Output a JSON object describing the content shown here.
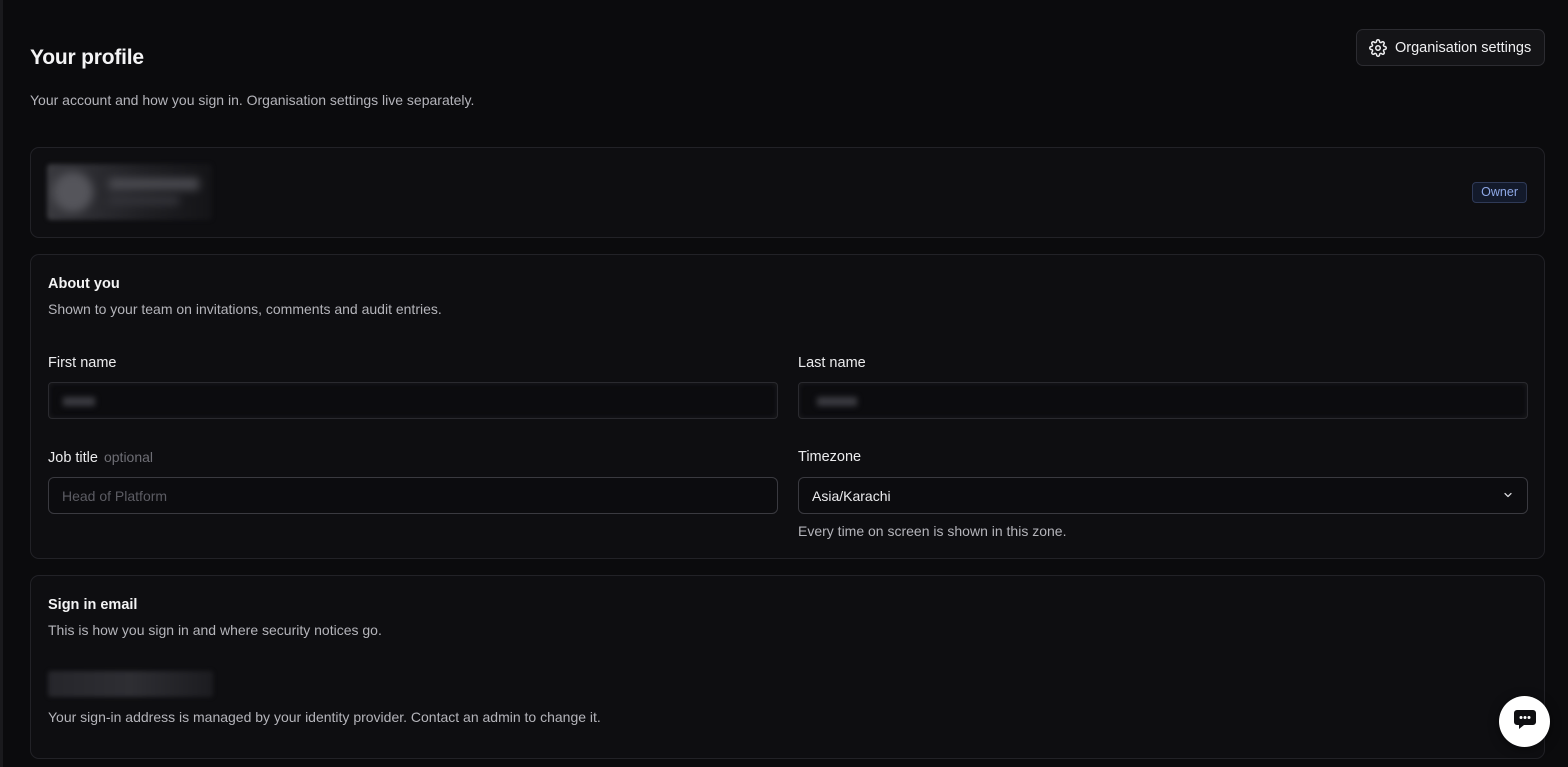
{
  "header": {
    "title": "Your profile",
    "subtitle": "Your account and how you sign in. Organisation settings live separately.",
    "org_settings_label": "Organisation settings"
  },
  "profile": {
    "role_badge": "Owner"
  },
  "about": {
    "title": "About you",
    "description": "Shown to your team on invitations, comments and audit entries.",
    "first_name_label": "First name",
    "last_name_label": "Last name",
    "job_title_label": "Job title",
    "job_title_optional": "optional",
    "job_title_placeholder": "Head of Platform",
    "timezone_label": "Timezone",
    "timezone_value": "Asia/Karachi",
    "timezone_help": "Every time on screen is shown in this zone."
  },
  "email": {
    "title": "Sign in email",
    "description": "This is how you sign in and where security notices go.",
    "note": "Your sign-in address is managed by your identity provider. Contact an admin to change it."
  },
  "icons": {
    "org_settings": "gear-icon",
    "timezone_dropdown": "chevron-down-icon",
    "chat": "chat-bubble-icon"
  },
  "colors": {
    "background": "#0b0b0d",
    "card": "#0e0e11",
    "badge_text": "#8ea8e6",
    "chat_button": "#ffffff"
  }
}
